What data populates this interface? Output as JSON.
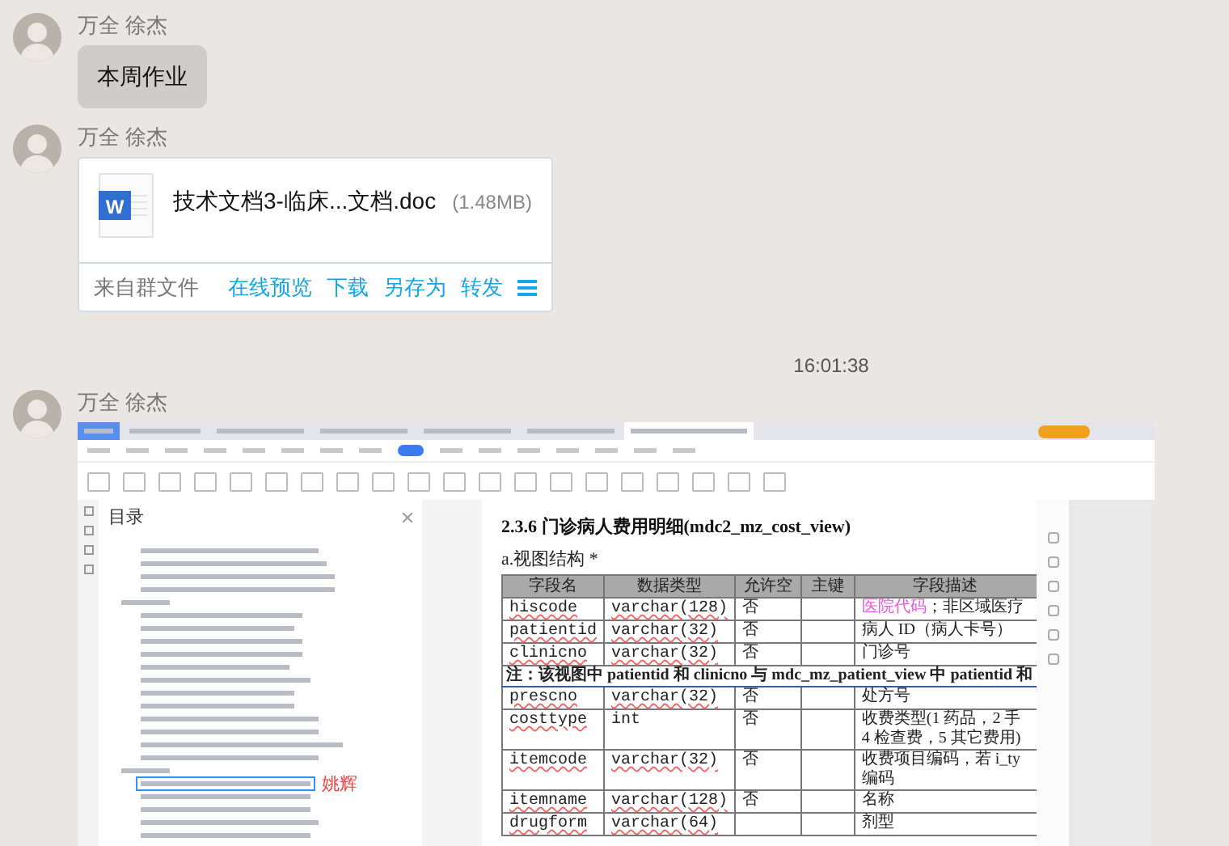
{
  "messages": [
    {
      "kind": "text",
      "sender": "万全 徐杰",
      "text": "本周作业"
    },
    {
      "kind": "file",
      "sender": "万全 徐杰",
      "file": {
        "icon_letter": "W",
        "name": "技术文档3-临床...文档.doc",
        "size": "(1.48MB)",
        "source": "来自群文件",
        "actions": [
          "在线预览",
          "下载",
          "另存为",
          "转发"
        ]
      }
    },
    {
      "kind": "time",
      "text": "16:01:38"
    },
    {
      "kind": "screenshot",
      "sender": "万全 徐杰",
      "screenshot": {
        "toc_title": "目录",
        "toc_note": "姚辉",
        "doc": {
          "heading": "2.3.6 门诊病人费用明细(mdc2_mz_cost_view)",
          "subheading": "a.视图结构 *",
          "columns": [
            "字段名",
            "数据类型",
            "允许空",
            "主键",
            "字段描述"
          ],
          "rows": [
            {
              "kind": "field",
              "name": "hiscode",
              "type": "varchar(128)",
              "nullable": "否",
              "description_parts": [
                {
                  "text": "医院代码",
                  "color": "#ee55dd"
                },
                {
                  "text": "；非区域医疗"
                }
              ]
            },
            {
              "kind": "field",
              "name": "patientid",
              "type": "varchar(32)",
              "nullable": "否",
              "description": "病人 ID（病人卡号）"
            },
            {
              "kind": "field",
              "name": "clinicno",
              "type": "varchar(32)",
              "nullable": "否",
              "description": "门诊号"
            },
            {
              "kind": "note",
              "text": "注：该视图中 patientid 和 clinicno 与 mdc_mz_patient_view 中 patientid 和"
            },
            {
              "kind": "field",
              "name": "prescno",
              "type": "varchar(32)",
              "nullable": "否",
              "description": "处方号"
            },
            {
              "kind": "field",
              "name": "costtype",
              "type": "int",
              "nullable": "否",
              "description": "收费类型(1 药品，2 手\n4 检查费，5 其它费用)"
            },
            {
              "kind": "field",
              "name": "itemcode",
              "type": "varchar(32)",
              "nullable": "否",
              "description": "收费项目编码，若 i_ty\n编码"
            },
            {
              "kind": "field",
              "name": "itemname",
              "type": "varchar(128)",
              "nullable": "否",
              "description": "名称"
            },
            {
              "kind": "field",
              "name": "drugform",
              "type": "varchar(64)",
              "description": "剂型"
            }
          ]
        }
      }
    }
  ]
}
